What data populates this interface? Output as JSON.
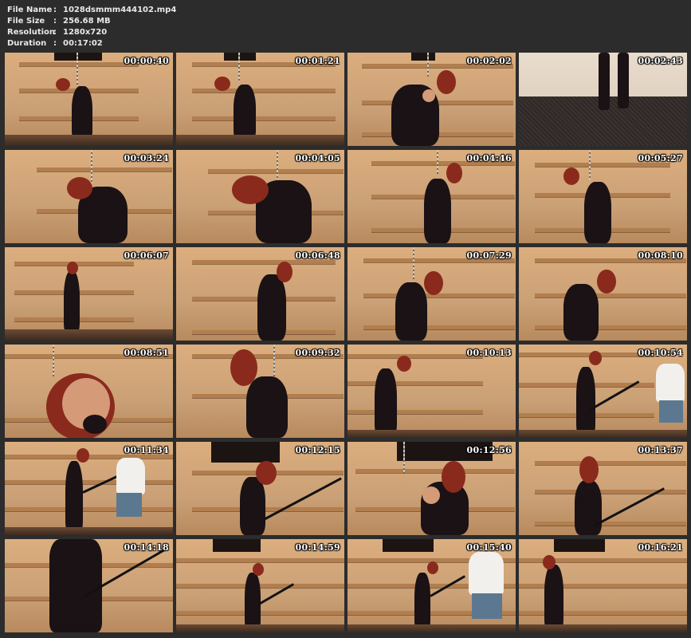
{
  "file_info": {
    "rows": [
      {
        "label": "File Name",
        "sep": ":",
        "value": "1028dsmmm444102.mp4"
      },
      {
        "label": "File Size",
        "sep": ":",
        "value": "256.68 MB"
      },
      {
        "label": "Resolution",
        "sep": ":",
        "value": "1280x720"
      },
      {
        "label": "Duration",
        "sep": ":",
        "value": "00:17:02"
      }
    ]
  },
  "thumbnails": [
    {
      "time": "00:00:40"
    },
    {
      "time": "00:01:21"
    },
    {
      "time": "00:02:02"
    },
    {
      "time": "00:02:43"
    },
    {
      "time": "00:03:24"
    },
    {
      "time": "00:04:05"
    },
    {
      "time": "00:04:46"
    },
    {
      "time": "00:05:27"
    },
    {
      "time": "00:06:07"
    },
    {
      "time": "00:06:48"
    },
    {
      "time": "00:07:29"
    },
    {
      "time": "00:08:10"
    },
    {
      "time": "00:08:51"
    },
    {
      "time": "00:09:32"
    },
    {
      "time": "00:10:13"
    },
    {
      "time": "00:10:54"
    },
    {
      "time": "00:11:34"
    },
    {
      "time": "00:12:15"
    },
    {
      "time": "00:12:56"
    },
    {
      "time": "00:13:37"
    },
    {
      "time": "00:14:18"
    },
    {
      "time": "00:14:59"
    },
    {
      "time": "00:15:40"
    },
    {
      "time": "00:16:21"
    }
  ],
  "colors": {
    "background": "#2c2c2c",
    "header_text": "#e8e8e8",
    "timestamp_text": "#ffffff",
    "wall": "#dcae7e",
    "board": "#b27e4e"
  }
}
